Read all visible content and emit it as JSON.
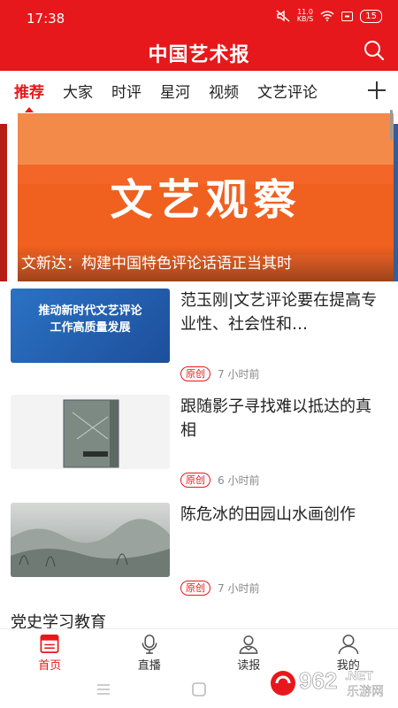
{
  "status_bar": {
    "time": "17:38",
    "net_speed_value": "11.0",
    "net_speed_unit": "KB/S",
    "battery": "15"
  },
  "header": {
    "title": "中国艺术报"
  },
  "tabs": [
    {
      "label": "推荐",
      "active": true
    },
    {
      "label": "大家"
    },
    {
      "label": "时评"
    },
    {
      "label": "星河"
    },
    {
      "label": "视频"
    },
    {
      "label": "文艺评论"
    }
  ],
  "banner": {
    "big_text": "文艺观察",
    "caption": "文新达：构建中国特色评论话语正当其时"
  },
  "news": [
    {
      "title": "范玉刚|文艺评论要在提高专业性、社会性和…",
      "thumb_text_line1": "推动新时代文艺评论",
      "thumb_text_line2": "工作高质量发展",
      "badge": "原创",
      "time": "7 小时前"
    },
    {
      "title": "跟随影子寻找难以抵达的真相",
      "badge": "原创",
      "time": "6 小时前"
    },
    {
      "title": "陈危冰的田园山水画创作",
      "badge": "原创",
      "time": "7 小时前"
    }
  ],
  "section_title": "党史学习教育",
  "bottom_nav": [
    {
      "label": "首页",
      "icon": "news-icon",
      "active": true
    },
    {
      "label": "直播",
      "icon": "microphone-icon"
    },
    {
      "label": "读报",
      "icon": "reader-icon"
    },
    {
      "label": "我的",
      "icon": "user-icon"
    }
  ],
  "watermark": {
    "number": "962",
    "suffix": ".NET",
    "site": "乐游网"
  },
  "colors": {
    "brand_red": "#e7181b",
    "banner_orange": "#f36628"
  }
}
